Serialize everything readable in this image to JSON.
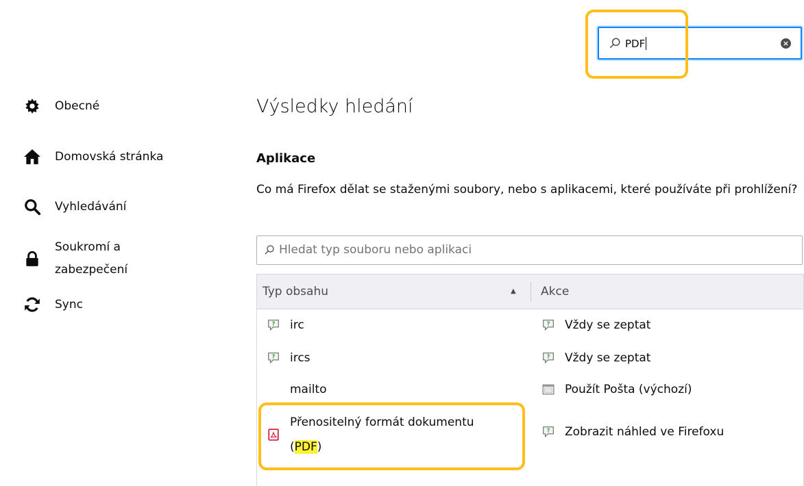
{
  "search": {
    "value": "PDF"
  },
  "sidebar": {
    "items": [
      {
        "label": "Obecné",
        "icon": "gear-icon"
      },
      {
        "label": "Domovská stránka",
        "icon": "home-icon"
      },
      {
        "label": "Vyhledávání",
        "icon": "search-icon"
      },
      {
        "label": "Soukromí a zabezpečení",
        "icon": "lock-icon"
      },
      {
        "label": "Sync",
        "icon": "sync-icon"
      }
    ]
  },
  "main": {
    "title": "Výsledky hledání",
    "section_title": "Aplikace",
    "description": "Co má Firefox dělat se staženými soubory, nebo s aplikacemi, které používáte při prohlížení?",
    "filter_placeholder": "Hledat typ souboru nebo aplikaci",
    "table": {
      "headers": {
        "type": "Typ obsahu",
        "action": "Akce"
      },
      "rows": [
        {
          "type": "irc",
          "type_icon": "chat-icon",
          "action": "Vždy se zeptat",
          "action_icon": "chat-icon"
        },
        {
          "type": "ircs",
          "type_icon": "chat-icon",
          "action": "Vždy se zeptat",
          "action_icon": "chat-icon"
        },
        {
          "type": "mailto",
          "type_icon": "",
          "action": "Použít Pošta (výchozí)",
          "action_icon": "window-icon"
        },
        {
          "type_prefix": "Přenositelný formát dokumentu",
          "type_open": "(",
          "type_match": "PDF",
          "type_close": ")",
          "type_icon": "pdf-icon",
          "action": "Zobrazit náhled ve Firefoxu",
          "action_icon": "chat-icon"
        }
      ]
    }
  },
  "colors": {
    "accent": "#0a84ff",
    "highlight_box": "#ffbe1a",
    "match_highlight": "#fff133"
  }
}
